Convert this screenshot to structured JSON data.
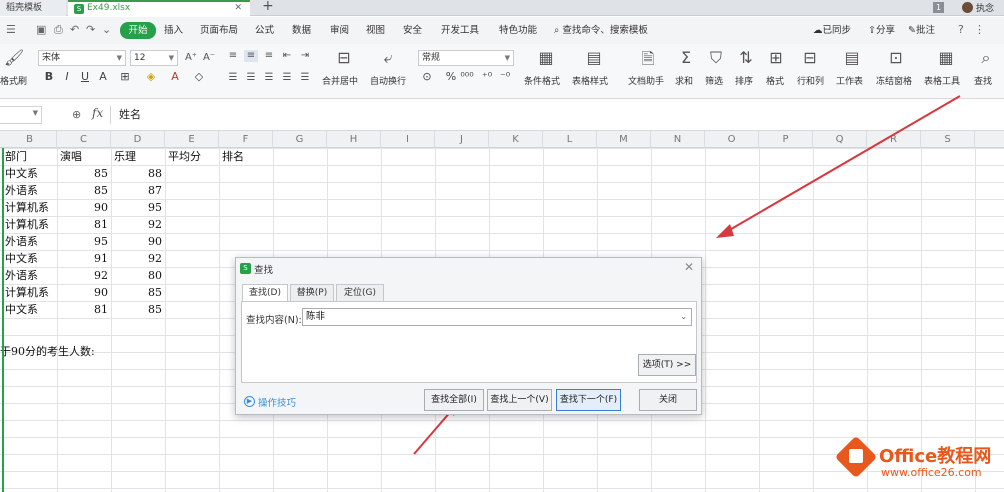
{
  "titlebar": {
    "tab_templates": "稻壳模板",
    "tab_file": "Ex49.xlsx",
    "tab_file_icon": "S",
    "add": "+",
    "badge": "1",
    "user": "执念"
  },
  "menu": {
    "items": [
      "开始",
      "插入",
      "页面布局",
      "公式",
      "数据",
      "审阅",
      "视图",
      "安全",
      "开发工具",
      "特色功能"
    ],
    "search": "查找命令、搜索模板",
    "right": [
      "已同步",
      "分享",
      "批注"
    ]
  },
  "ribbon": {
    "paste_label": "格式刷",
    "font_name": "宋体",
    "font_size": "12",
    "number_format": "常规",
    "merge_center": "合并居中",
    "wrap_text": "自动换行",
    "cond_format": "条件格式",
    "table_style": "表格样式",
    "doc_helper": "文档助手",
    "sum": "求和",
    "filter": "筛选",
    "sort": "排序",
    "format": "格式",
    "rows_cols": "行和列",
    "worksheet": "工作表",
    "freeze": "冻结窗格",
    "table_tools": "表格工具",
    "find": "查找"
  },
  "formula_bar": {
    "fx": "fx",
    "value": "姓名"
  },
  "columns": [
    "B",
    "C",
    "D",
    "E",
    "F",
    "G",
    "H",
    "I",
    "J",
    "K",
    "L",
    "M",
    "N",
    "O",
    "P",
    "Q",
    "R",
    "S"
  ],
  "sheet": {
    "headers": [
      "部门",
      "演唱",
      "乐理",
      "平均分",
      "排名"
    ],
    "rows": [
      [
        "中文系",
        "85",
        "88"
      ],
      [
        "外语系",
        "85",
        "87"
      ],
      [
        "计算机系",
        "90",
        "95"
      ],
      [
        "计算机系",
        "81",
        "92"
      ],
      [
        "外语系",
        "95",
        "90"
      ],
      [
        "中文系",
        "91",
        "92"
      ],
      [
        "外语系",
        "92",
        "80"
      ],
      [
        "计算机系",
        "90",
        "85"
      ],
      [
        "中文系",
        "81",
        "85"
      ]
    ],
    "note": "于90分的考生人数:"
  },
  "dialog": {
    "title": "查找",
    "tabs": [
      "查找(D)",
      "替换(P)",
      "定位(G)"
    ],
    "find_label": "查找内容(N):",
    "find_value": "陈非",
    "options_button": "选项(T) >>",
    "tips": "操作技巧",
    "buttons": {
      "find_all": "查找全部(I)",
      "find_prev": "查找上一个(V)",
      "find_next": "查找下一个(F)",
      "close": "关闭"
    }
  },
  "watermark": {
    "title": "Office教程网",
    "url": "www.office26.com"
  },
  "colors": {
    "accent": "#27a149",
    "arrow": "#d9363e",
    "watermark": "#e8581c"
  }
}
